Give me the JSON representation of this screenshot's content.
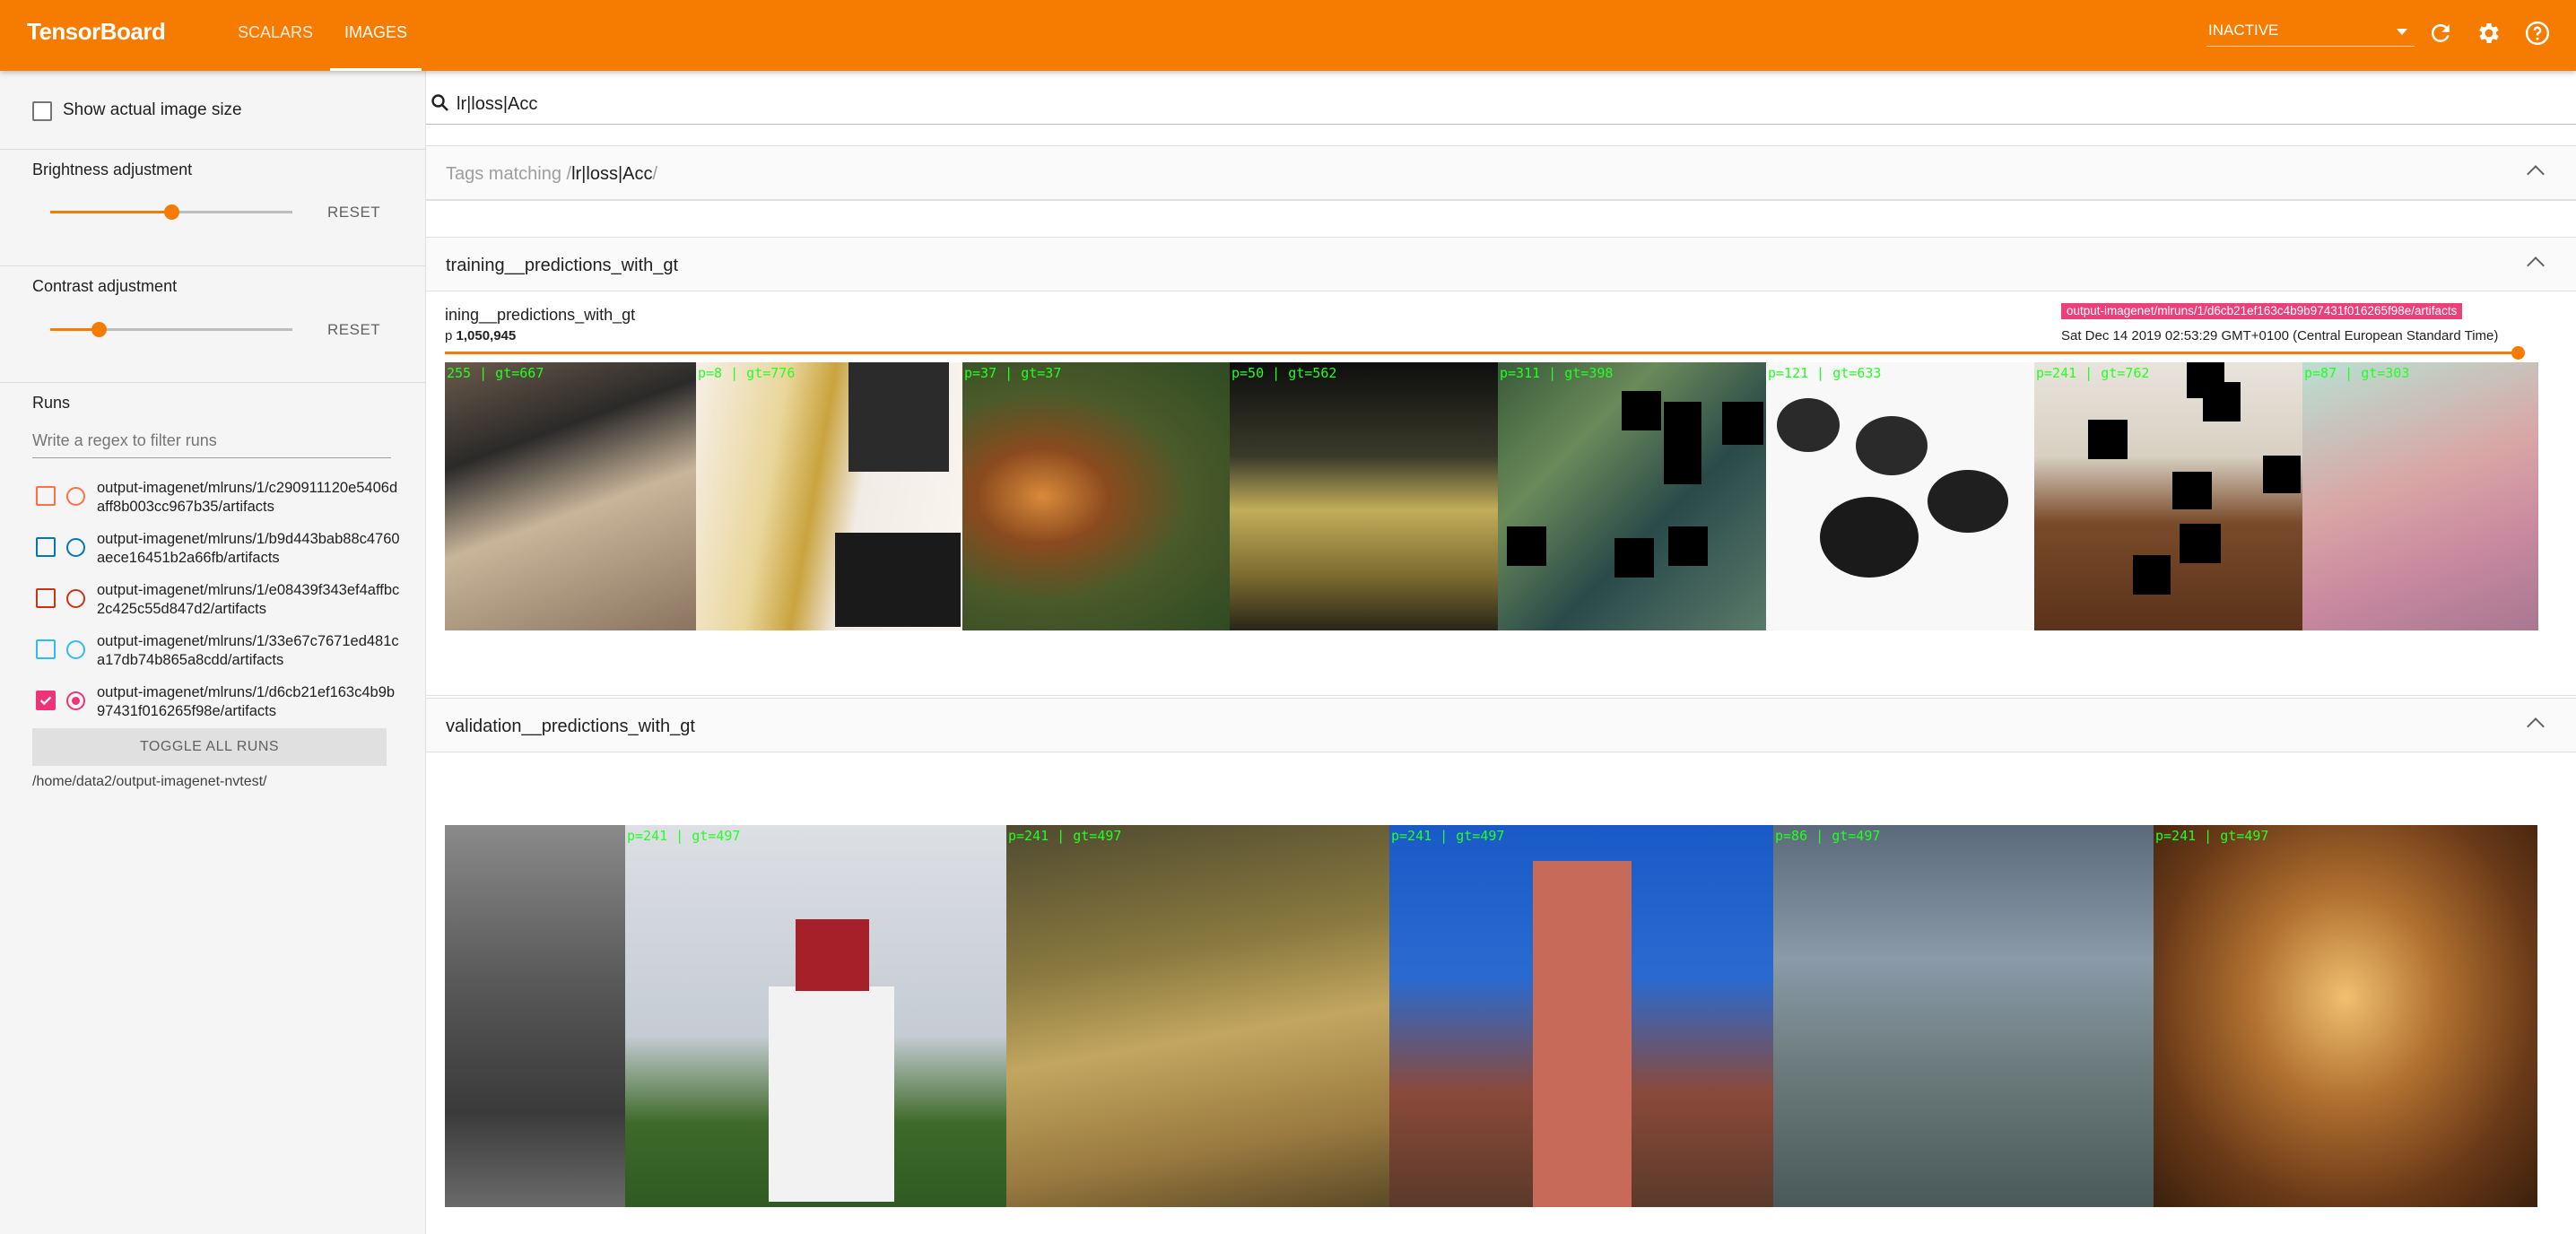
{
  "app": {
    "brand": "TensorBoard",
    "tabs": [
      {
        "label": "SCALARS"
      },
      {
        "label": "IMAGES"
      }
    ],
    "status": "INACTIVE",
    "accent_color": "#f57c00"
  },
  "sidebar": {
    "show_actual_size_label": "Show actual image size",
    "brightness": {
      "label": "Brightness adjustment",
      "reset": "RESET",
      "level": 0.5
    },
    "contrast": {
      "label": "Contrast adjustment",
      "reset": "RESET",
      "level": 0.2
    },
    "runs": {
      "title": "Runs",
      "filter_placeholder": "Write a regex to filter runs",
      "items": [
        {
          "text": "output-imagenet/mlruns/1/c290911120e5406daff8b003cc967b35/artifacts",
          "color": "#ff7043",
          "checked": false
        },
        {
          "text": "output-imagenet/mlruns/1/b9d443bab88c4760aece16451b2a66fb/artifacts",
          "color": "#0077bb",
          "checked": false
        },
        {
          "text": "output-imagenet/mlruns/1/e08439f343ef4affbc2c425c55d847d2/artifacts",
          "color": "#cc3311",
          "checked": false
        },
        {
          "text": "output-imagenet/mlruns/1/33e67c7671ed481ca17db74b865a8cdd/artifacts",
          "color": "#33bbee",
          "checked": false
        },
        {
          "text": "output-imagenet/mlruns/1/d6cb21ef163c4b9b97431f016265f98e/artifacts",
          "color": "#ee3377",
          "checked": true
        }
      ],
      "toggle_all": "TOGGLE ALL RUNS",
      "logdir": "/home/data2/output-imagenet-nvtest/"
    }
  },
  "search": {
    "value": "lr|loss|Acc"
  },
  "cards": {
    "tags_matching": {
      "prefix": "Tags matching /",
      "pattern": "lr|loss|Acc",
      "suffix": "/"
    },
    "training": {
      "title": "training__predictions_with_gt",
      "image_name": "ining__predictions_with_gt",
      "step_prefix": "p",
      "step_value": "1,050,945",
      "run_chip": "output-imagenet/mlruns/1/d6cb21ef163c4b9b97431f016265f98e/artifacts",
      "timestamp": "Sat Dec 14 2019 02:53:29 GMT+0100 (Central European Standard Time)",
      "labels": [
        "255 | gt=667",
        "p=8 | gt=776",
        "p=37 | gt=37",
        "p=50 | gt=562",
        "p=311 | gt=398",
        "p=121 | gt=633",
        "p=241 | gt=762",
        "p=87 | gt=303"
      ]
    },
    "validation": {
      "title": "validation__predictions_with_gt",
      "labels": [
        "",
        "p=241 | gt=497",
        "p=241 | gt=497",
        "p=241 | gt=497",
        "p=86 | gt=497",
        "p=241 | gt=497"
      ]
    }
  }
}
